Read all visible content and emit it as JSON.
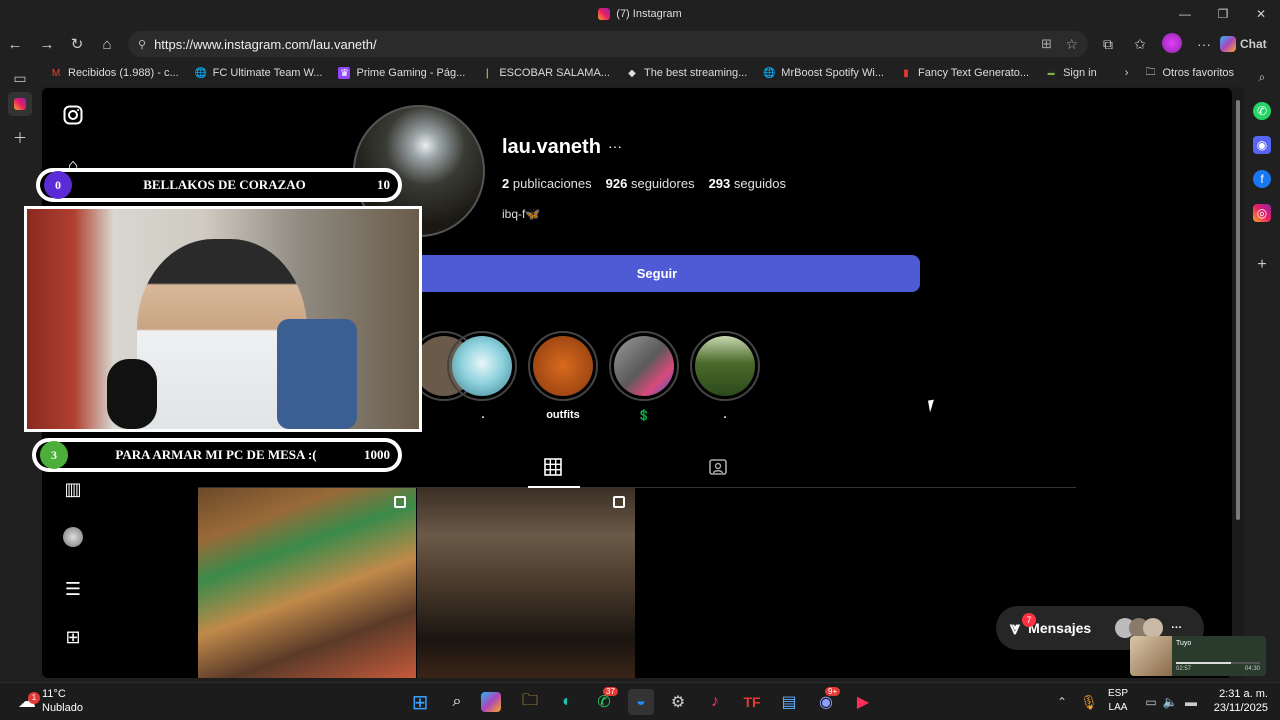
{
  "window": {
    "title": "(7) Instagram"
  },
  "browser": {
    "url": "https://www.instagram.com/lau.vaneth/",
    "chat_label": "Chat",
    "bookmarks": [
      {
        "label": "Recibidos (1.988) - c..."
      },
      {
        "label": "FC Ultimate Team W..."
      },
      {
        "label": "Prime Gaming - Pág..."
      },
      {
        "label": "ESCOBAR SALAMA..."
      },
      {
        "label": "The best streaming..."
      },
      {
        "label": "MrBoost Spotify Wi..."
      },
      {
        "label": "Fancy Text Generato..."
      },
      {
        "label": "Sign in"
      }
    ],
    "other_favorites": "Otros favoritos"
  },
  "profile": {
    "username": "lau.vaneth",
    "more": "···",
    "posts_count": "2",
    "posts_label": "publicaciones",
    "followers_count": "926",
    "followers_label": "seguidores",
    "following_count": "293",
    "following_label": "seguidos",
    "bio": "ibq-f🦋",
    "follow_button": "Seguir",
    "highlights": [
      {
        "label": "."
      },
      {
        "label": "outfits"
      },
      {
        "label": "💲"
      },
      {
        "label": "."
      }
    ]
  },
  "overlay": {
    "goal_top": {
      "current": "0",
      "label": "BELLAKOS DE CORAZAO",
      "target": "10"
    },
    "goal_bottom": {
      "current": "3",
      "label": "PARA ARMAR MI PC DE MESA :(",
      "target": "1000"
    }
  },
  "messages": {
    "label": "Mensajes",
    "badge": "7"
  },
  "mini_player": {
    "title": "Tuyo",
    "time_start": "02:57",
    "time_end": "04:30"
  },
  "taskbar": {
    "temperature": "11°C",
    "weather": "Nublado",
    "weather_badge": "1",
    "whatsapp_badge": "37",
    "discord_badge": "9+",
    "lang_top": "ESP",
    "lang_bottom": "LAA",
    "time": "2:31 a. m.",
    "date": "23/11/2025"
  }
}
